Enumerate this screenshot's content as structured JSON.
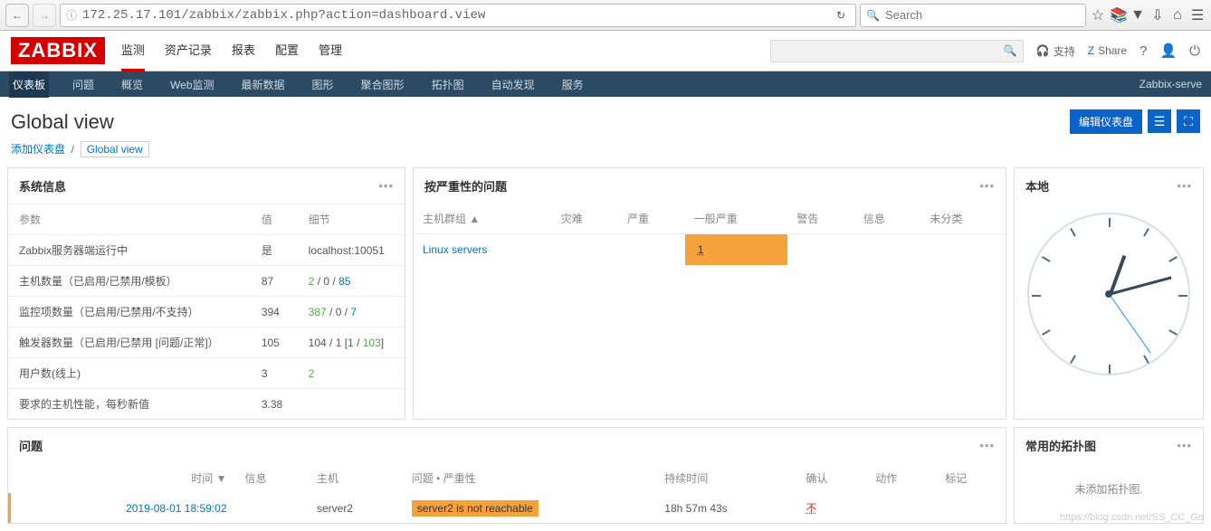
{
  "browser": {
    "url": "172.25.17.101/zabbix/zabbix.php?action=dashboard.view",
    "search_placeholder": "Search"
  },
  "header": {
    "logo": "ZABBIX",
    "menu": [
      "监测",
      "资产记录",
      "报表",
      "配置",
      "管理"
    ],
    "active_menu": 0,
    "support": "支持",
    "share": "Share"
  },
  "subnav": {
    "items": [
      "仪表板",
      "问题",
      "概览",
      "Web监测",
      "最新数据",
      "图形",
      "聚合图形",
      "拓扑图",
      "自动发现",
      "服务"
    ],
    "active": 0,
    "right": "Zabbix-serve"
  },
  "page": {
    "title": "Global view",
    "edit_btn": "编辑仪表盘"
  },
  "breadcrumb": {
    "add": "添加仪表盘",
    "current": "Global view"
  },
  "system_info": {
    "title": "系统信息",
    "cols": [
      "参数",
      "值",
      "细节"
    ],
    "rows": [
      {
        "param": "Zabbix服务器端运行中",
        "value": "是",
        "detail": "localhost:10051",
        "value_green": true
      },
      {
        "param": "主机数量（已启用/已禁用/模板）",
        "value": "87",
        "detail": "2 / 0 / 85",
        "detail_parts": [
          {
            "t": "2",
            "c": "green"
          },
          {
            "t": " / "
          },
          {
            "t": "0"
          },
          {
            "t": " / "
          },
          {
            "t": "85",
            "c": "blue"
          }
        ]
      },
      {
        "param": "监控项数量（已启用/已禁用/不支持）",
        "value": "394",
        "detail_parts": [
          {
            "t": "387",
            "c": "green"
          },
          {
            "t": " / "
          },
          {
            "t": "0"
          },
          {
            "t": " / "
          },
          {
            "t": "7",
            "c": "blue"
          }
        ]
      },
      {
        "param": "触发器数量（已启用/已禁用 [问题/正常]）",
        "value": "105",
        "detail_parts": [
          {
            "t": "104 / 1 ["
          },
          {
            "t": "1",
            "c": "blue"
          },
          {
            "t": " / "
          },
          {
            "t": "103",
            "c": "green"
          },
          {
            "t": "]"
          }
        ]
      },
      {
        "param": "用户数(线上)",
        "value": "3",
        "detail_parts": [
          {
            "t": "2",
            "c": "green"
          }
        ]
      },
      {
        "param": "要求的主机性能，每秒新值",
        "value": "3.38",
        "detail": ""
      }
    ]
  },
  "severity": {
    "title": "按严重性的问题",
    "cols": [
      "主机群组 ▲",
      "灾难",
      "严重",
      "一般严重",
      "警告",
      "信息",
      "未分类"
    ],
    "row": {
      "group": "Linux servers",
      "average": "1"
    }
  },
  "clock": {
    "title": "本地"
  },
  "problems": {
    "title": "问题",
    "cols": [
      "时间 ▼",
      "信息",
      "主机",
      "问题 • 严重性",
      "持续时间",
      "确认",
      "动作",
      "标记"
    ],
    "row": {
      "time": "2019-08-01 18:59:02",
      "host": "server2",
      "problem": "server2 is not reachable",
      "duration": "18h 57m 43s",
      "ack": "不"
    }
  },
  "maps": {
    "title": "常用的拓扑图",
    "empty": "未添加拓扑图."
  },
  "watermark": "https://blog.csdn.net/SS_CC_Go"
}
